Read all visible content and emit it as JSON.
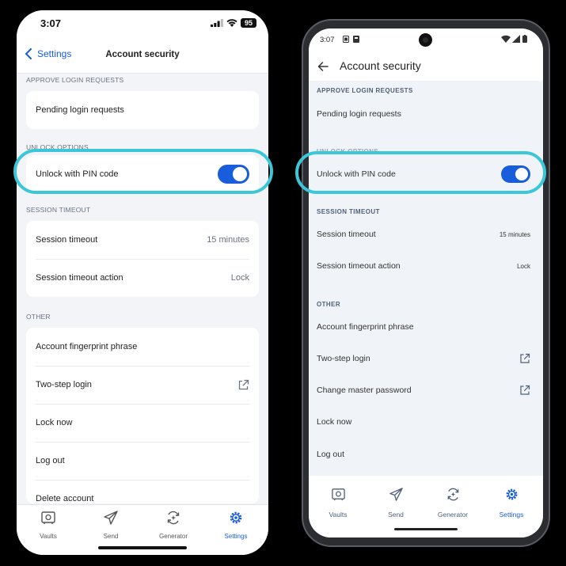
{
  "ios": {
    "status": {
      "time": "3:07",
      "battery": "95"
    },
    "nav": {
      "back_label": "Settings",
      "title": "Account security"
    },
    "sections": {
      "approve": "APPROVE LOGIN REQUESTS",
      "unlock": "UNLOCK OPTIONS",
      "session": "SESSION TIMEOUT",
      "other": "OTHER"
    },
    "pending": "Pending login requests",
    "unlock_pin": {
      "label": "Unlock with PIN code",
      "enabled": true
    },
    "session_timeout": {
      "label": "Session timeout",
      "value": "15 minutes"
    },
    "session_action": {
      "label": "Session timeout action",
      "value": "Lock"
    },
    "other_items": [
      "Account fingerprint phrase",
      "Two-step login",
      "Lock now",
      "Log out",
      "Delete account"
    ],
    "tabs": [
      "Vaults",
      "Send",
      "Generator",
      "Settings"
    ],
    "active_tab": "Settings"
  },
  "android": {
    "status": {
      "time": "3:07"
    },
    "header": {
      "title": "Account security"
    },
    "sections": {
      "approve": "APPROVE LOGIN REQUESTS",
      "unlock": "UNLOCK OPTIONS",
      "session": "SESSION TIMEOUT",
      "other": "OTHER"
    },
    "pending": "Pending login requests",
    "unlock_pin": {
      "label": "Unlock with PIN code",
      "enabled": true
    },
    "session_timeout": {
      "label": "Session timeout",
      "value": "15 minutes"
    },
    "session_action": {
      "label": "Session timeout action",
      "value": "Lock"
    },
    "other_items": [
      "Account fingerprint phrase",
      "Two-step login",
      "Change master password",
      "Lock now",
      "Log out"
    ],
    "tabs": [
      "Vaults",
      "Send",
      "Generator",
      "Settings"
    ],
    "active_tab": "Settings"
  },
  "colors": {
    "accent": "#175ddc",
    "highlight": "#3cc6d9",
    "background": "#f2f4f8"
  }
}
